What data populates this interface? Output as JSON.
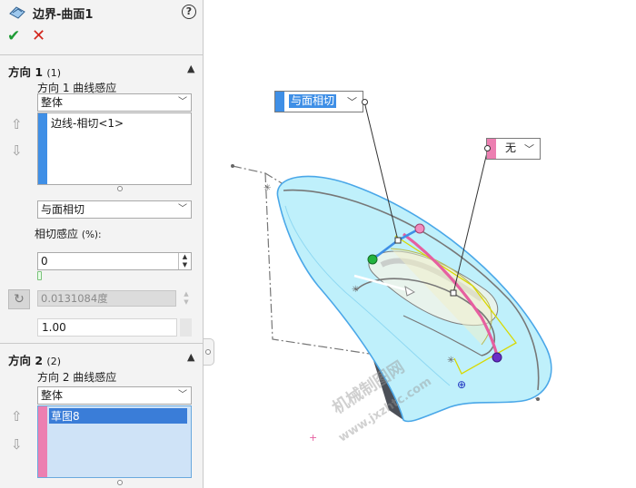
{
  "panel": {
    "title": "边界-曲面1",
    "ok_symbol": "✔",
    "cancel_symbol": "✕",
    "help_symbol": "?",
    "direction1": {
      "title": "方向 1",
      "count": "(1)",
      "curve_influence_label": "方向 1 曲线感应",
      "curve_influence_value": "整体",
      "list_item": "边线-相切<1>",
      "tangency_value": "与面相切",
      "tangent_influence_label": "相切感应",
      "tangent_influence_unit": "(%):",
      "tangent_influence_value": "0",
      "angle_value": "0.0131084度",
      "ratio_value": "1.00"
    },
    "direction2": {
      "title": "方向 2",
      "count": "(2)",
      "curve_influence_label": "方向 2 曲线感应",
      "curve_influence_value": "整体",
      "list_item": "草图8"
    }
  },
  "viewport": {
    "callout1_value": "与面相切",
    "callout2_value": "无",
    "watermark1": "机械制图网",
    "watermark2": "www.jxzhtc.com"
  },
  "colors": {
    "dir1_strip": "#3f8fe6",
    "dir2_strip": "#ec7fb1",
    "surface": "#bff0fb",
    "surface_edge": "#4aa7e8",
    "ok": "#1e9b35",
    "cancel": "#d3261d"
  }
}
